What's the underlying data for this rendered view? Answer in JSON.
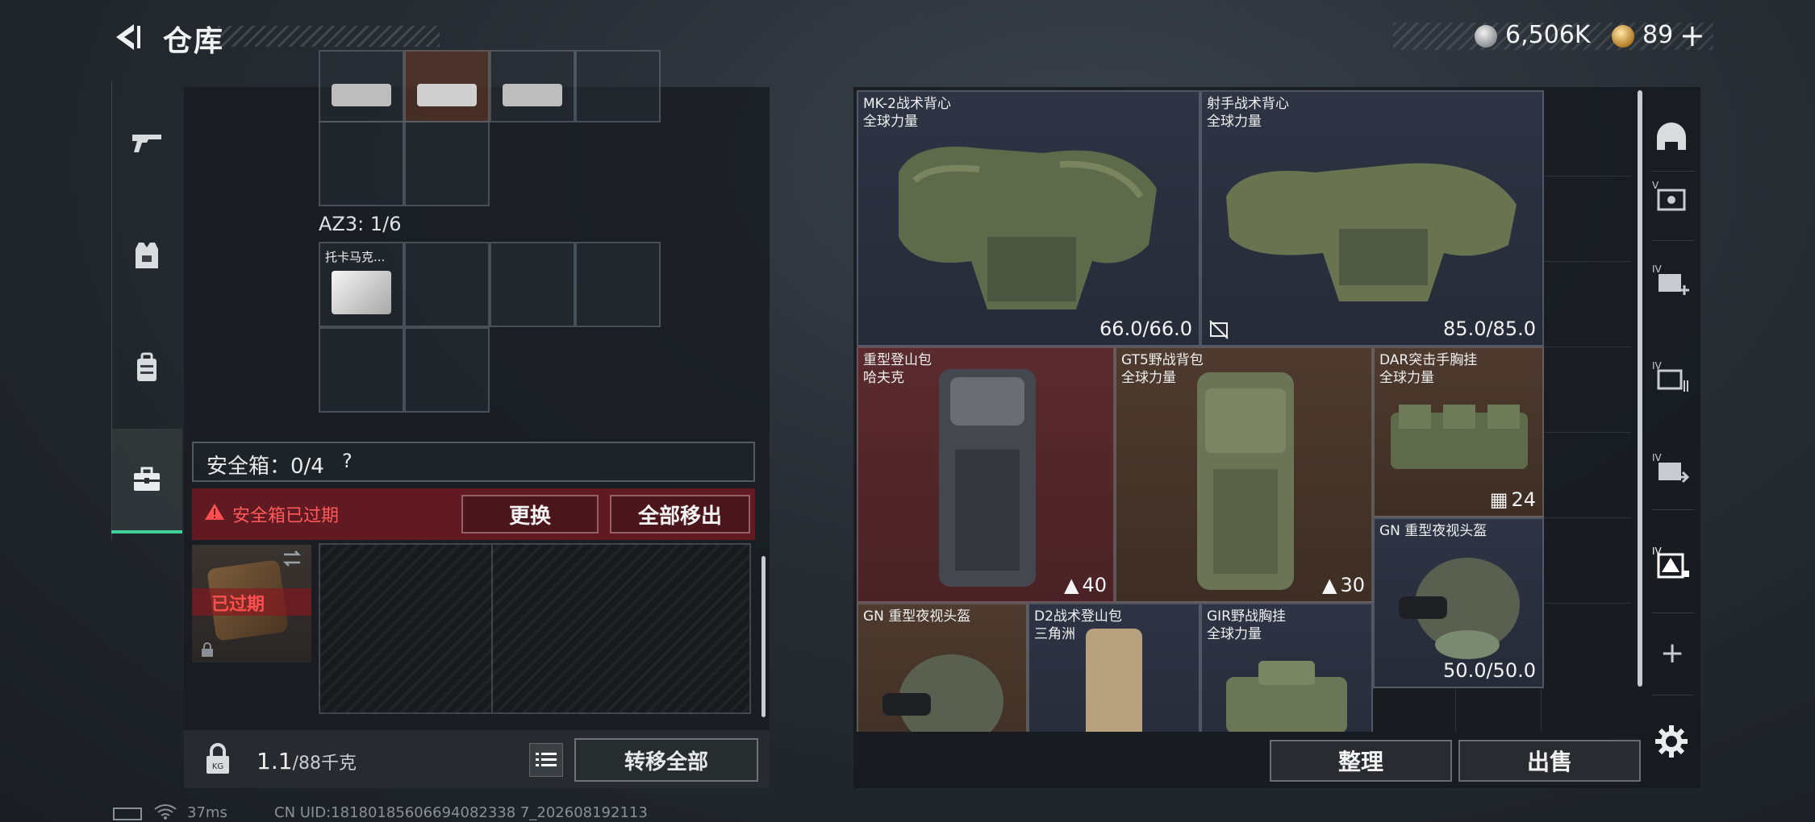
{
  "header": {
    "title": "仓库"
  },
  "currency": {
    "silver": "6,506K",
    "gold": "89",
    "add": "+"
  },
  "left": {
    "container_label": "AZ3: 1/6",
    "container_item": "托卡马克...",
    "safe_box_label": "安全箱：0/4",
    "help": "?",
    "expired_notice": "安全箱已过期",
    "replace_label": "更换",
    "remove_all_label": "全部移出",
    "expired_badge": "已过期",
    "weight_value": "1.1",
    "weight_unit": "/88千克",
    "transfer_all_label": "转移全部"
  },
  "status": {
    "ping": "37ms",
    "uid": "CN UID:18180185606694082338 7_202608192113"
  },
  "inventory": [
    {
      "name": "MK-2战术背心",
      "sub": "全球力量",
      "value": "66.0/66.0"
    },
    {
      "name": "射手战术背心",
      "sub": "全球力量",
      "value": "85.0/85.0"
    },
    {
      "name": "重型登山包",
      "sub": "哈夫克",
      "value": "40"
    },
    {
      "name": "GT5野战背包",
      "sub": "全球力量",
      "value": "30"
    },
    {
      "name": "DAR突击手胸挂",
      "sub": "全球力量",
      "value": "24"
    },
    {
      "name": "GN 重型夜视头盔",
      "sub": "",
      "value": "50.0/50.0"
    },
    {
      "name": "GN 重型夜视头盔",
      "sub": "",
      "value": ""
    },
    {
      "name": "D2战术登山包",
      "sub": "三角洲",
      "value": ""
    },
    {
      "name": "GIR野战胸挂",
      "sub": "全球力量",
      "value": ""
    }
  ],
  "actions": {
    "sort_label": "整理",
    "sell_label": "出售"
  },
  "right_rail": [
    "armor-icon",
    "vest-icon-v",
    "container-add-icon-iv",
    "container-list-icon-iv",
    "container-swap-icon-iv",
    "container-filter-icon-iv"
  ]
}
